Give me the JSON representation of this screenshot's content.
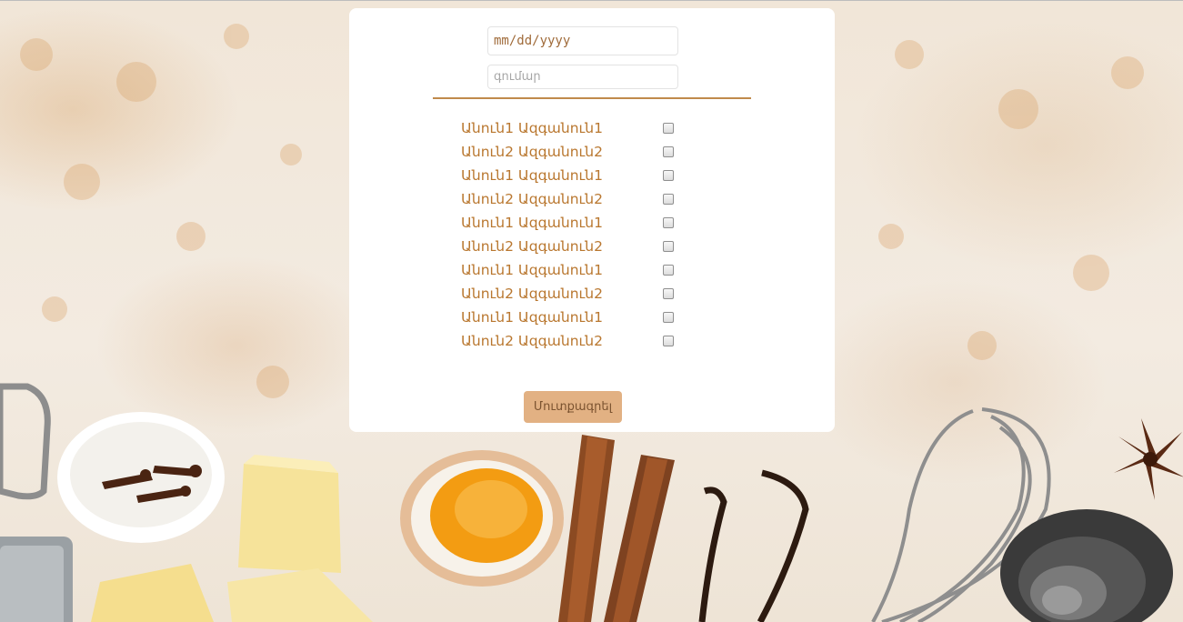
{
  "form": {
    "date_placeholder": "mm/dd/yyyy",
    "amount_placeholder": "գումար",
    "submit_label": "Մուտքագրել"
  },
  "people": [
    {
      "name": "Անուն1 Ազգանուն1",
      "checked": false
    },
    {
      "name": "Անուն2 Ազգանուն2",
      "checked": false
    },
    {
      "name": "Անուն1 Ազգանուն1",
      "checked": false
    },
    {
      "name": "Անուն2 Ազգանուն2",
      "checked": false
    },
    {
      "name": "Անուն1 Ազգանուն1",
      "checked": false
    },
    {
      "name": "Անուն2 Ազգանուն2",
      "checked": false
    },
    {
      "name": "Անուն1 Ազգանուն1",
      "checked": false
    },
    {
      "name": "Անուն2 Ազգանուն2",
      "checked": false
    },
    {
      "name": "Անուն1 Ազգանուն1",
      "checked": false
    },
    {
      "name": "Անուն2 Ազգանուն2",
      "checked": false
    }
  ],
  "colors": {
    "accent": "#b9772f",
    "divider": "#c08a4c",
    "button_bg": "#e2b183",
    "button_text": "#7b5330",
    "card_bg": "#ffffff"
  }
}
